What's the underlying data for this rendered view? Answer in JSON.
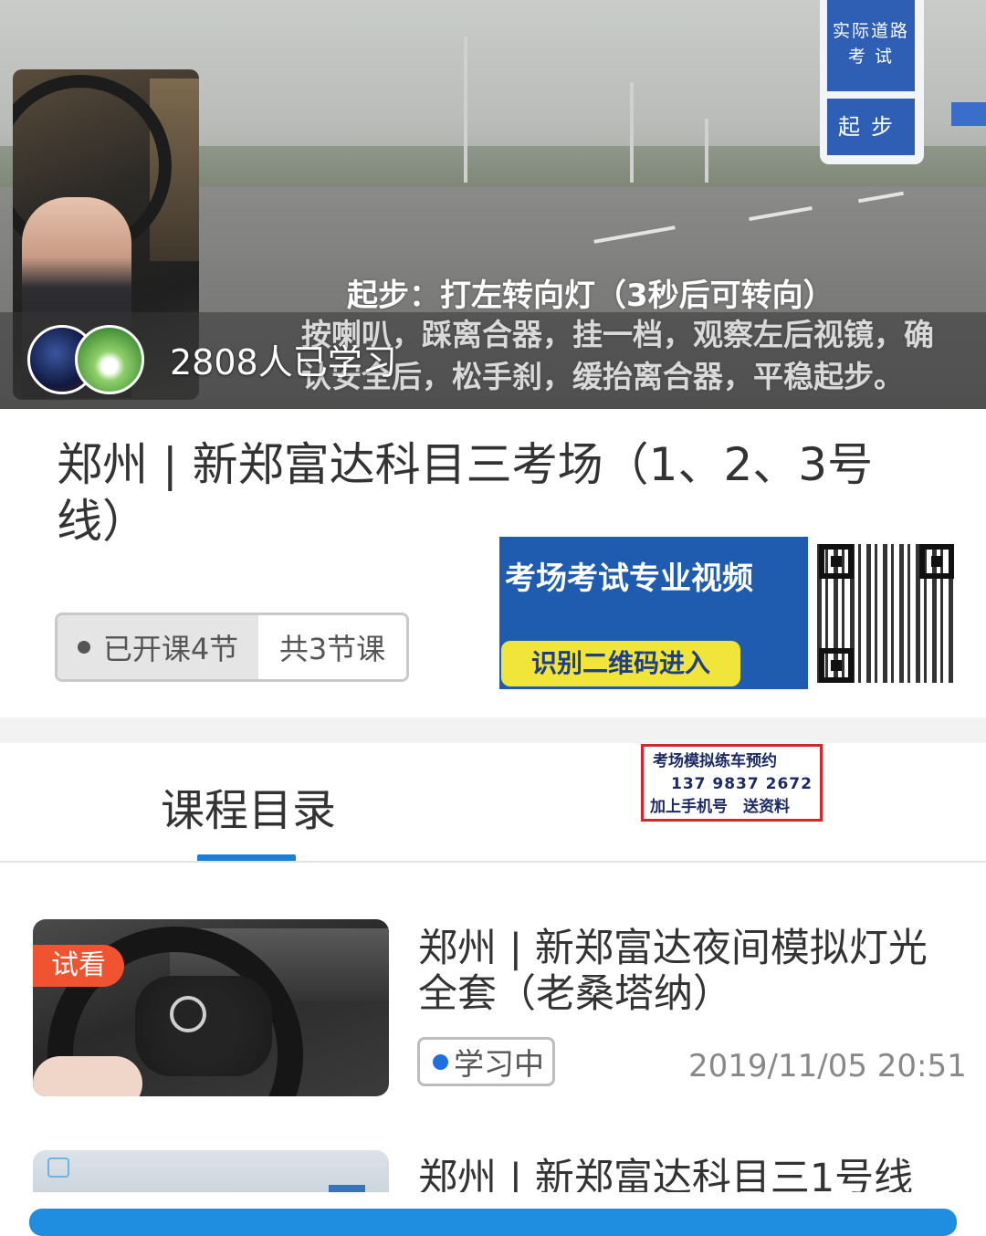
{
  "hero": {
    "caption_line1": "起步：打左转向灯（3秒后可转向）",
    "caption_line2": "按喇叭，踩离合器，挂一档，观察左后视镜，确认安全后，松手刹，缓抬离合器，平稳起步。",
    "sign_top": "实际道路考 试",
    "sign_bottom": "起步",
    "learners_text": "2808人已学习"
  },
  "course": {
    "title": "郑州 | 新郑富达科目三考场（1、2、3号线）",
    "opened_label": "已开课4节",
    "total_label": "共3节课"
  },
  "promo": {
    "headline": "考场考试专业视频",
    "cta": "识别二维码进入"
  },
  "tabs": {
    "catalog": "课程目录"
  },
  "ad": {
    "line1": "考场模拟练车预约",
    "line2": "137 9837 2672",
    "line3": "加上手机号　送资料"
  },
  "lessons": [
    {
      "badge": "试看",
      "title": "郑州 | 新郑富达夜间模拟灯光全套（老桑塔纳）",
      "status": "学习中",
      "time": "2019/11/05 20:51"
    },
    {
      "title": "郑州 | 新郑富达科目三1号线"
    }
  ],
  "colors": {
    "accent": "#1a7fd6",
    "trial_badge": "#f0532f",
    "promo_bg": "#1f5cb0",
    "promo_cta": "#f2e53a",
    "ad_border": "#d6262a"
  }
}
